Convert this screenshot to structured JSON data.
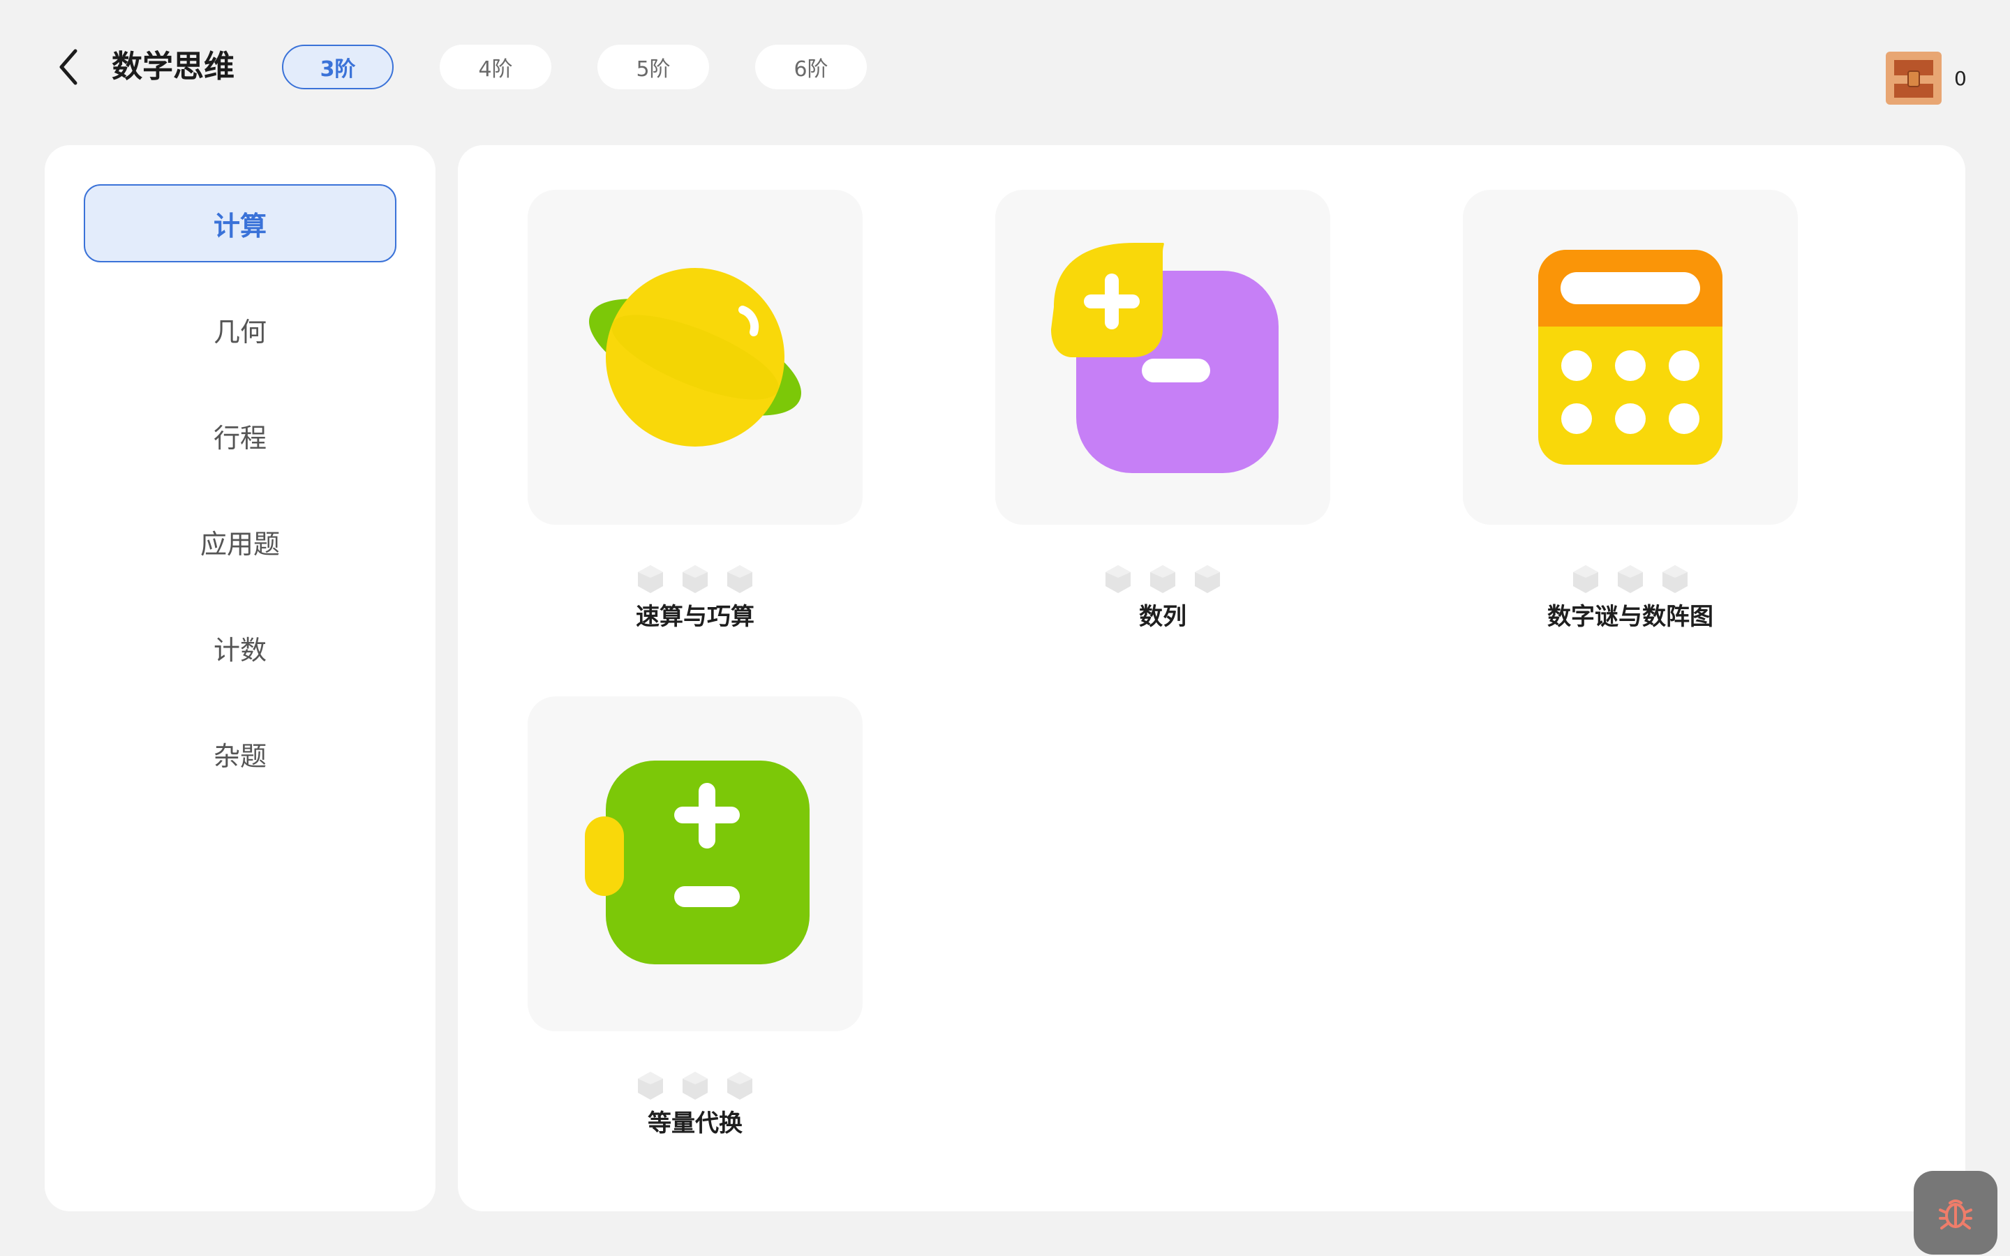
{
  "header": {
    "title": "数学思维",
    "levels": [
      {
        "label": "3阶",
        "active": true
      },
      {
        "label": "4阶",
        "active": false
      },
      {
        "label": "5阶",
        "active": false
      },
      {
        "label": "6阶",
        "active": false
      }
    ],
    "coin_count": "0"
  },
  "sidebar": {
    "items": [
      {
        "label": "计算",
        "active": true
      },
      {
        "label": "几何",
        "active": false
      },
      {
        "label": "行程",
        "active": false
      },
      {
        "label": "应用题",
        "active": false
      },
      {
        "label": "计数",
        "active": false
      },
      {
        "label": "杂题",
        "active": false
      }
    ]
  },
  "cards": [
    {
      "label": "速算与巧算",
      "icon": "planet-icon",
      "stars": 3
    },
    {
      "label": "数列",
      "icon": "plus-minus-icon",
      "stars": 3
    },
    {
      "label": "数字谜与数阵图",
      "icon": "calculator-icon",
      "stars": 3
    },
    {
      "label": "等量代换",
      "icon": "equation-board-icon",
      "stars": 3
    }
  ],
  "colors": {
    "accent": "#3a72d8",
    "accent_bg": "#e3ecfb",
    "yellow": "#f9d80a",
    "green": "#7cc808",
    "purple": "#c67ff6",
    "orange": "#fa9508"
  }
}
